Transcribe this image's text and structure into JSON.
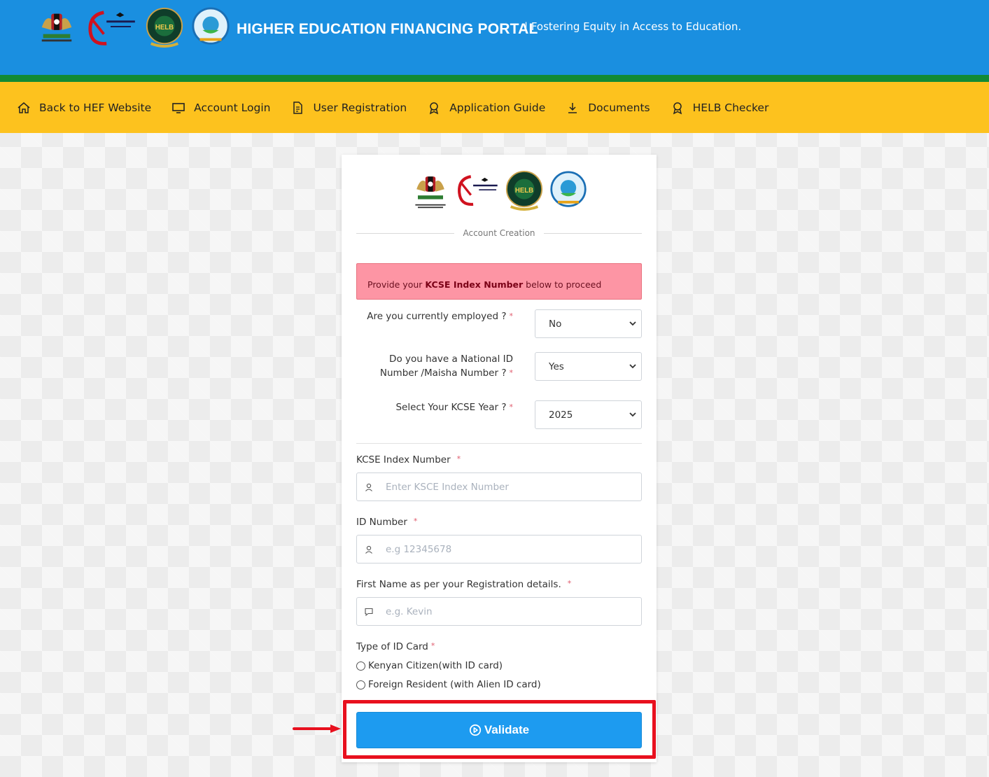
{
  "header": {
    "title": "HIGHER EDUCATION FINANCING PORTAL",
    "tagline": "| Fostering Equity in Access to Education.",
    "logos": [
      "kenya-coat-of-arms-logo",
      "ministry-of-education-logo",
      "helb-logo",
      "universities-fund-logo"
    ],
    "colors": {
      "top": "#1a8fe0",
      "stripe": "#128a35",
      "nav": "#fdc21e"
    }
  },
  "nav": {
    "items": [
      {
        "label": "Back to HEF Website",
        "icon": "home-icon"
      },
      {
        "label": "Account Login",
        "icon": "monitor-icon"
      },
      {
        "label": "User Registration",
        "icon": "document-icon"
      },
      {
        "label": "Application Guide",
        "icon": "award-icon"
      },
      {
        "label": "Documents",
        "icon": "download-icon"
      },
      {
        "label": "HELB Checker",
        "icon": "award-icon"
      }
    ]
  },
  "form": {
    "section_title": "Account Creation",
    "alert": {
      "prefix": "Provide your ",
      "bold": "KCSE Index Number",
      "suffix": " below to proceed"
    },
    "employed": {
      "label": "Are you currently employed ?",
      "value": "No"
    },
    "national_id": {
      "label_line1": "Do you have a National ID",
      "label_line2": "Number /Maisha Number ?",
      "value": "Yes"
    },
    "kcse_year": {
      "label": "Select Your KCSE Year ?",
      "value": "2025"
    },
    "kcse_index": {
      "label": "KCSE Index Number",
      "placeholder": "Enter KSCE Index Number"
    },
    "id_number": {
      "label": "ID Number",
      "placeholder": "e.g 12345678"
    },
    "first_name": {
      "label": "First Name as per your Registration details.",
      "placeholder": "e.g. Kevin"
    },
    "id_type": {
      "label": "Type of ID Card",
      "options": [
        "Kenyan Citizen(with ID card)",
        "Foreign Resident (with Alien ID card)"
      ]
    },
    "required_mark": "*",
    "validate_label": "Validate",
    "accent": "#1d9bf0",
    "highlight_color": "#e8101e"
  }
}
